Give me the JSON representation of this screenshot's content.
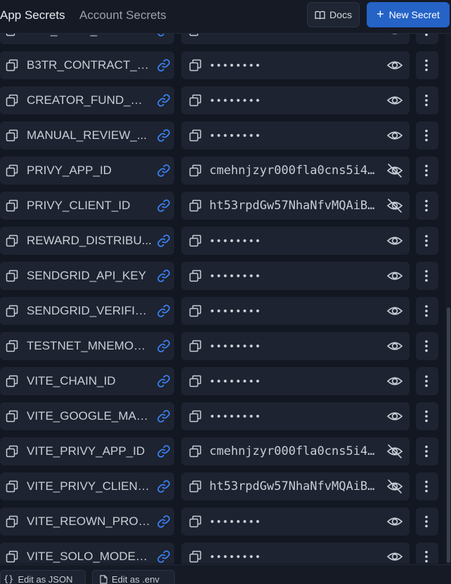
{
  "header": {
    "tabs": [
      {
        "label": "App Secrets",
        "active": true
      },
      {
        "label": "Account Secrets",
        "active": false
      }
    ],
    "docs_label": "Docs",
    "new_secret_label": "New Secret"
  },
  "secrets": [
    {
      "name": "APP_FUND_WALLET",
      "value": "••••••••",
      "masked": true
    },
    {
      "name": "B3TR_CONTRACT_A...",
      "value": "••••••••",
      "masked": true
    },
    {
      "name": "CREATOR_FUND_WA...",
      "value": "••••••••",
      "masked": true
    },
    {
      "name": "MANUAL_REVIEW_...",
      "value": "••••••••",
      "masked": true
    },
    {
      "name": "PRIVY_APP_ID",
      "value": "cmehnjzyr000fla0cns5i4...",
      "masked": false
    },
    {
      "name": "PRIVY_CLIENT_ID",
      "value": "ht53rpdGw57NhaNfvMQAiB...",
      "masked": false
    },
    {
      "name": "REWARD_DISTRIBU...",
      "value": "••••••••",
      "masked": true
    },
    {
      "name": "SENDGRID_API_KEY",
      "value": "••••••••",
      "masked": true
    },
    {
      "name": "SENDGRID_VERIFIE...",
      "value": "••••••••",
      "masked": true
    },
    {
      "name": "TESTNET_MNEMONIC",
      "value": "••••••••",
      "masked": true
    },
    {
      "name": "VITE_CHAIN_ID",
      "value": "••••••••",
      "masked": true
    },
    {
      "name": "VITE_GOOGLE_MAP...",
      "value": "••••••••",
      "masked": true
    },
    {
      "name": "VITE_PRIVY_APP_ID",
      "value": "cmehnjzyr000fla0cns5i4...",
      "masked": false
    },
    {
      "name": "VITE_PRIVY_CLIENT...",
      "value": "ht53rpdGw57NhaNfvMQAiB...",
      "masked": false
    },
    {
      "name": "VITE_REOWN_PROJ...",
      "value": "••••••••",
      "masked": true
    },
    {
      "name": "VITE_SOLO_MODE_...",
      "value": "••••••••",
      "masked": true
    }
  ],
  "footer": {
    "edit_json_label": "Edit as JSON",
    "edit_env_label": "Edit as .env"
  },
  "colors": {
    "accent": "#2563c7",
    "link": "#3b82f6",
    "background": "#121722",
    "panel": "#1d2330"
  },
  "icons": {
    "copy": "copy-icon",
    "link": "link-icon",
    "visible": "eye-icon",
    "hidden": "eye-off-icon",
    "menu": "kebab-menu-icon",
    "docs": "book-icon",
    "json": "braces-icon",
    "env": "file-icon"
  }
}
